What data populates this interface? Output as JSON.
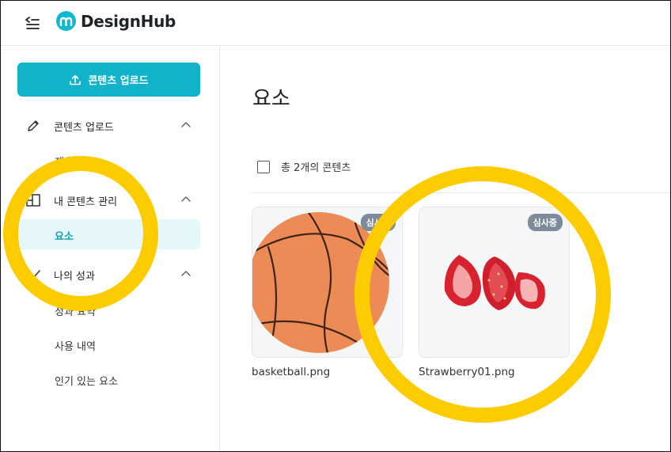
{
  "app": {
    "logo_text": "DesignHub",
    "brand_color": "#10b8cf"
  },
  "topbar": {
    "menu_icon": "collapse-menu-icon"
  },
  "sidebar": {
    "upload_button_label": "콘텐츠 업로드",
    "sections": [
      {
        "label": "콘텐츠 업로드",
        "icon": "pencil-icon",
        "expanded": true
      },
      {
        "label": "내 콘텐츠 관리",
        "icon": "layout-icon",
        "expanded": true
      },
      {
        "label": "나의 성과",
        "icon": "chart-line-icon",
        "expanded": true
      }
    ],
    "subitems": {
      "upload_sub": "제출하기",
      "active": "요소",
      "perf_1": "성과 요약",
      "perf_2": "사용 내역",
      "perf_3": "인기 있는 요소"
    }
  },
  "main": {
    "title": "요소",
    "count_text": "총 2개의 콘텐츠",
    "cards": [
      {
        "filename": "basketball.png",
        "badge": "심사중",
        "image": "basketball"
      },
      {
        "filename": "Strawberry01.png",
        "badge": "심사중",
        "image": "strawberries"
      }
    ]
  },
  "annotation_color": "#fccb00"
}
